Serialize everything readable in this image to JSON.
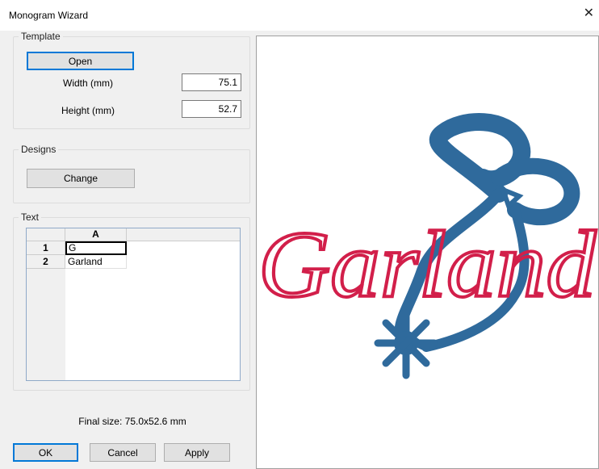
{
  "window": {
    "title": "Monogram Wizard",
    "close_glyph": "✕"
  },
  "template": {
    "legend": "Template",
    "open_label": "Open",
    "width_label": "Width (mm)",
    "width_value": "75.1",
    "height_label": "Height (mm)",
    "height_value": "52.7"
  },
  "designs": {
    "legend": "Designs",
    "change_label": "Change"
  },
  "text": {
    "legend": "Text",
    "column_header": "A",
    "rows": [
      {
        "num": "1",
        "value": "G"
      },
      {
        "num": "2",
        "value": "Garland"
      }
    ]
  },
  "final_size": "Final size: 75.0x52.6 mm",
  "buttons": {
    "ok": "OK",
    "cancel": "Cancel",
    "apply": "Apply"
  },
  "preview": {
    "text": "Garland",
    "text_color": "#d21f4a",
    "motif_color": "#2f6a9c"
  }
}
